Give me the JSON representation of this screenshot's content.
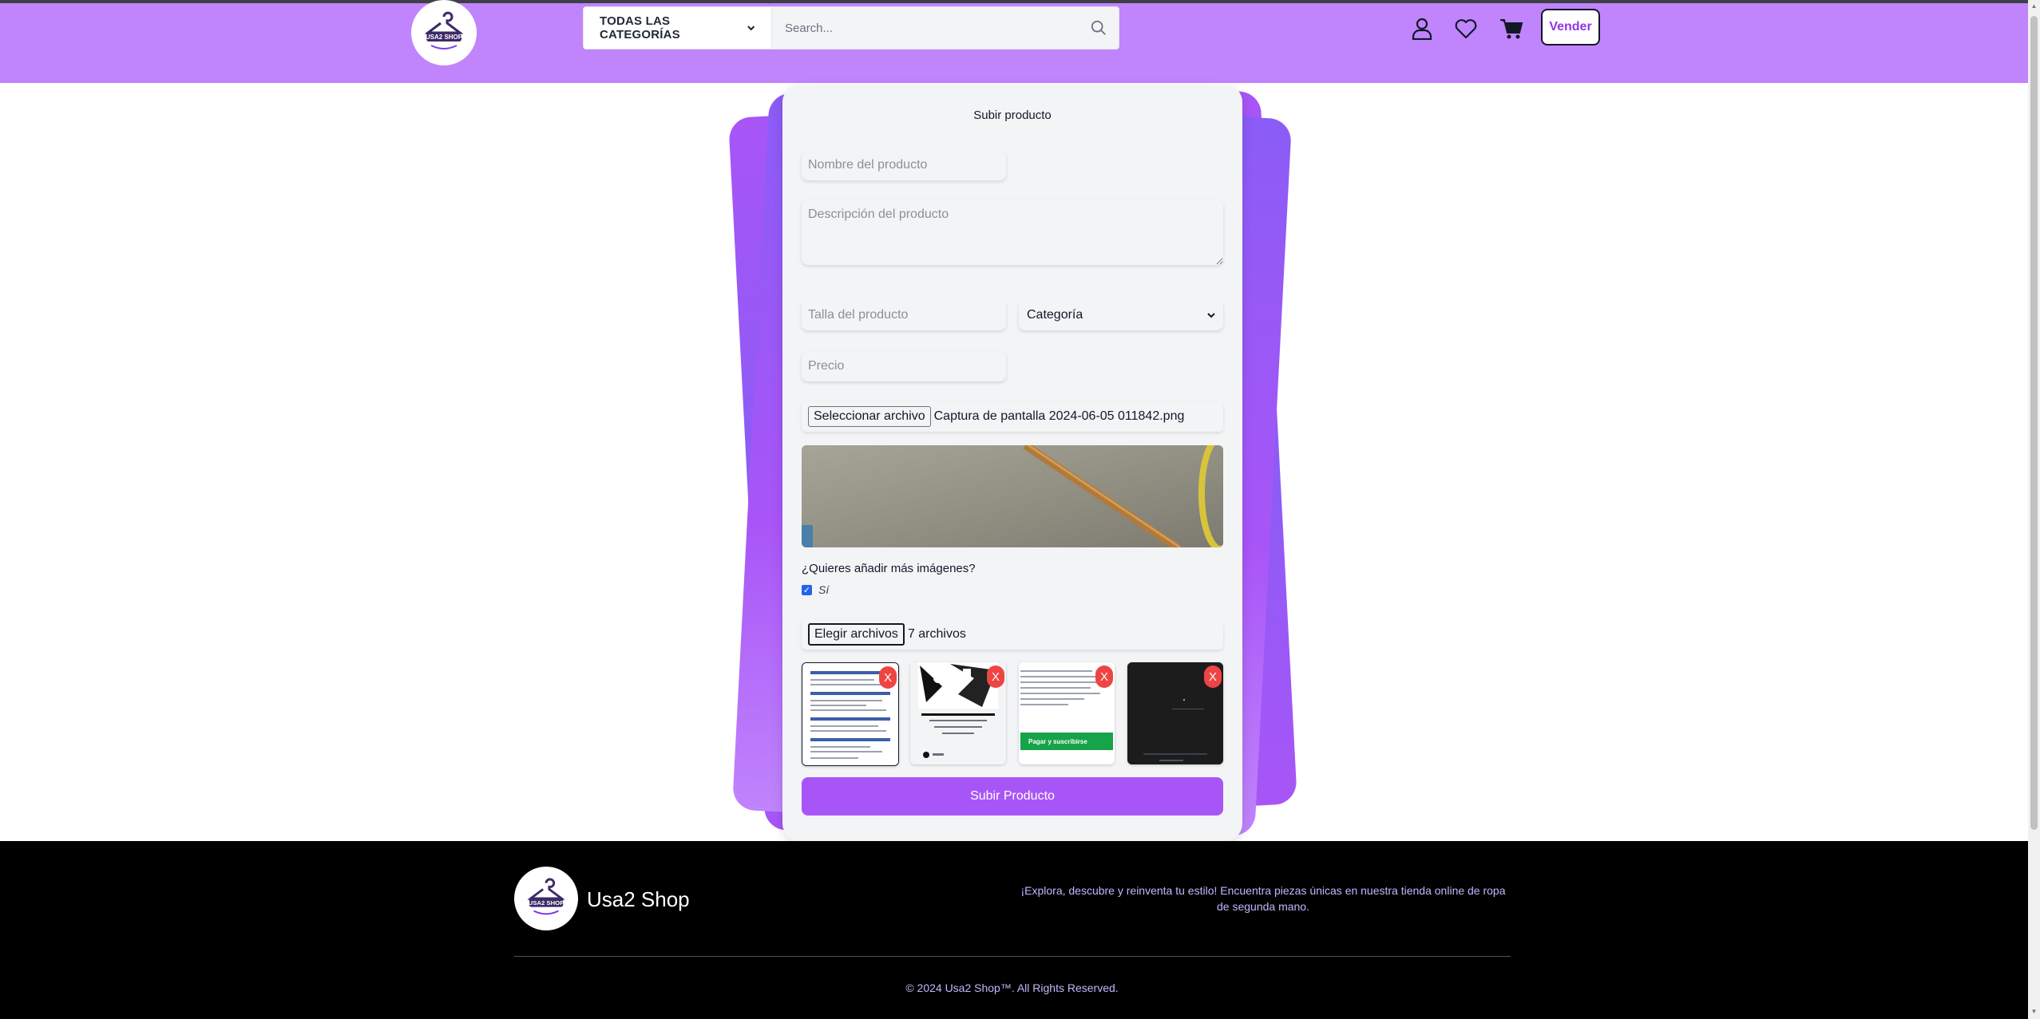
{
  "header": {
    "logo_text": "USA2 SHOP",
    "category_select": "TODAS LAS CATEGORÍAS",
    "search_placeholder": "Search...",
    "sell_label": "Vender",
    "icons": [
      "user-icon",
      "heart-icon",
      "cart-icon",
      "search-icon"
    ],
    "background_color": "#c084fc"
  },
  "form": {
    "title": "Subir producto",
    "name_placeholder": "Nombre del producto",
    "description_placeholder": "Descripción del producto",
    "size_placeholder": "Talla del producto",
    "category_value": "Categoría",
    "price_placeholder": "Precio",
    "file_button_label": "Seleccionar archivo",
    "file_name": "Captura de pantalla 2024-06-05 011842.png",
    "more_images_question": "¿Quieres añadir más imágenes?",
    "more_images_checkbox_label": "Sí",
    "more_images_checked": true,
    "multi_file_button_label": "Elegir archivos",
    "multi_file_count": "7 archivos",
    "remove_label": "X",
    "thumb3_button_text": "Pagar y suscribirse",
    "submit_label": "Subir Producto",
    "accent_color": "#a855f7"
  },
  "footer": {
    "logo_text": "USA2 SHOP",
    "brand": "Usa2 Shop",
    "description": "¡Explora, descubre y reinventa tu estilo! Encuentra piezas únicas en nuestra tienda online de ropa de segunda mano.",
    "copyright": "© 2024 Usa2 Shop™. All Rights Reserved."
  }
}
